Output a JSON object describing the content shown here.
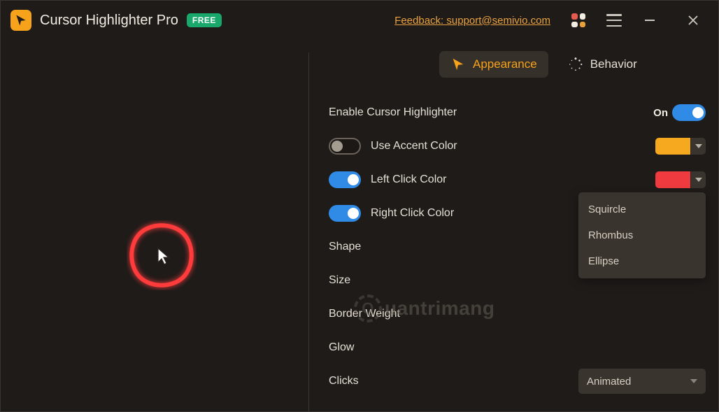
{
  "header": {
    "title": "Cursor Highlighter Pro",
    "badge": "FREE",
    "feedback": "Feedback: support@semivio.com",
    "grid_colors": [
      "#e65b4f",
      "#f2ece3",
      "#f2ece3",
      "#e9a13a"
    ]
  },
  "tabs": {
    "appearance": "Appearance",
    "behavior": "Behavior"
  },
  "settings": {
    "enable_label": "Enable Cursor Highlighter",
    "enable_state": "On",
    "accent_label": "Use Accent Color",
    "accent_color": "#f6a81e",
    "left_click_label": "Left Click Color",
    "left_click_color": "#ef3b3f",
    "right_click_label": "Right Click Color",
    "right_click_color": "#3d8fe3",
    "shape_label": "Shape",
    "shape_value": "Rhombus",
    "size_label": "Size",
    "border_label": "Border Weight",
    "glow_label": "Glow",
    "clicks_label": "Clicks",
    "clicks_value": "Animated"
  },
  "shape_options": {
    "o1": "Squircle",
    "o2": "Rhombus",
    "o3": "Ellipse"
  },
  "watermark": "uantrimang"
}
